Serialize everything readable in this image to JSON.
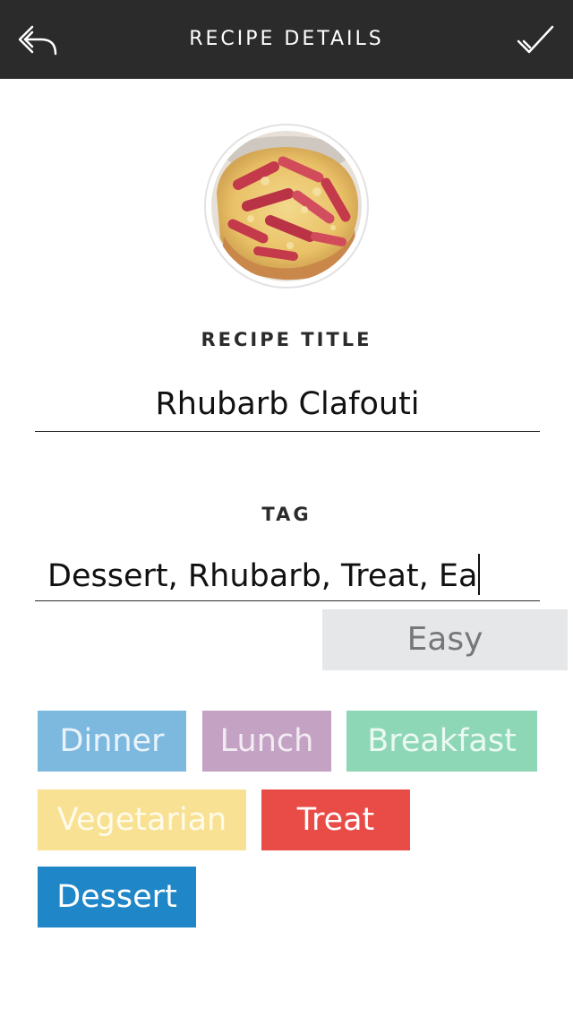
{
  "header": {
    "title": "RECIPE DETAILS",
    "back_icon": "reply-arrow-icon",
    "done_icon": "checkmark-icon"
  },
  "recipe": {
    "title_label": "RECIPE TITLE",
    "title_value": "Rhubarb Clafouti",
    "tag_label": "TAG",
    "tag_value": "Dessert, Rhubarb, Treat, Ea"
  },
  "suggestion": "Easy",
  "tags": [
    {
      "label": "Dinner",
      "bg": "#7db8df",
      "fg": "#e9f3fa"
    },
    {
      "label": "Lunch",
      "bg": "#c3a2c4",
      "fg": "#f3ebf3"
    },
    {
      "label": "Breakfast",
      "bg": "#8dd7b6",
      "fg": "#ecf9f3"
    },
    {
      "label": "Vegetarian",
      "bg": "#f8e193",
      "fg": "#fffbea"
    },
    {
      "label": "Treat",
      "bg": "#e94b47",
      "fg": "#ffffff"
    },
    {
      "label": "Dessert",
      "bg": "#1f87c8",
      "fg": "#ffffff"
    }
  ]
}
